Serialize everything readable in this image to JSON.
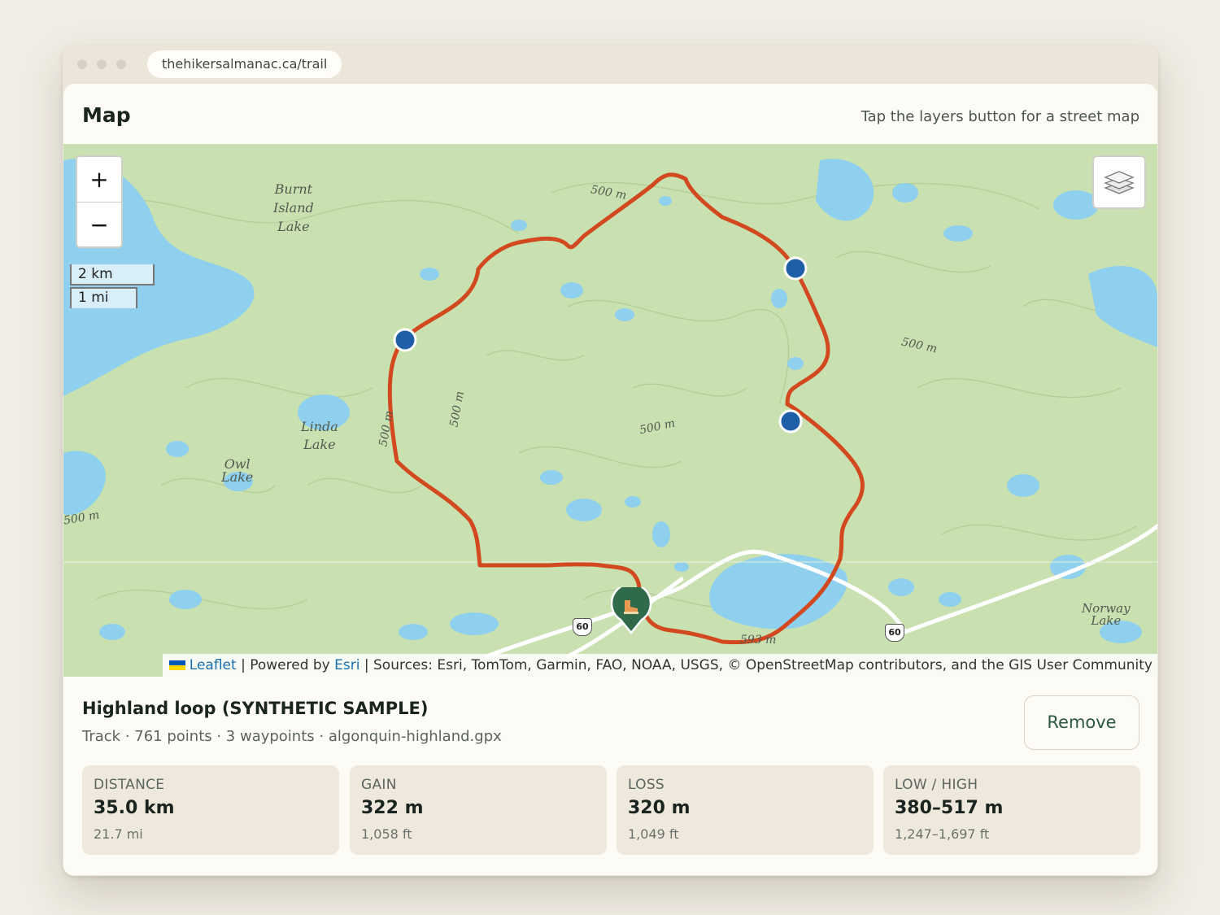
{
  "browser": {
    "url": "thehikersalmanac.ca/trail"
  },
  "card": {
    "title": "Map",
    "hint": "Tap the layers button for a street map"
  },
  "map": {
    "zoom_in": "+",
    "zoom_out": "−",
    "scale_metric": "2 km",
    "scale_imperial": "1 mi",
    "attribution": {
      "leaflet": "Leaflet",
      "separator1": " | Powered by ",
      "esri": "Esri",
      "sources": " | Sources: Esri, TomTom, Garmin, FAO, NOAA, USGS, © OpenStreetMap contributors, and the GIS User Community"
    },
    "labels": {
      "burnt_island_lake": [
        "Burnt",
        "Island",
        "Lake"
      ],
      "linda_lake": [
        "Linda",
        "Lake"
      ],
      "owl_lake": [
        "Owl",
        "Lake"
      ],
      "norway_lake": [
        "Norway",
        "Lake"
      ],
      "contour_500a": "500 m",
      "contour_500b": "500 m",
      "contour_500c": "500 m",
      "contour_500d": "500 m",
      "contour_500e": "500 m",
      "contour_500f": "500 m",
      "peak": "593 m",
      "highway_west": "60",
      "highway_east": "60"
    },
    "colors": {
      "track": "#d2491f",
      "waypoint": "#1f5fa8",
      "start_marker": "#2f6b4a",
      "water": "#8fd0ee",
      "land": "#c9e1b0"
    },
    "waypoint_count": 3
  },
  "track": {
    "title": "Highland loop (SYNTHETIC SAMPLE)",
    "meta": "Track · 761 points · 3 waypoints · algonquin-highland.gpx",
    "remove_label": "Remove"
  },
  "stats": [
    {
      "label": "DISTANCE",
      "value": "35.0 km",
      "sub": "21.7 mi"
    },
    {
      "label": "GAIN",
      "value": "322 m",
      "sub": "1,058 ft"
    },
    {
      "label": "LOSS",
      "value": "320 m",
      "sub": "1,049 ft"
    },
    {
      "label": "LOW / HIGH",
      "value": "380–517 m",
      "sub": "1,247–1,697 ft"
    }
  ]
}
